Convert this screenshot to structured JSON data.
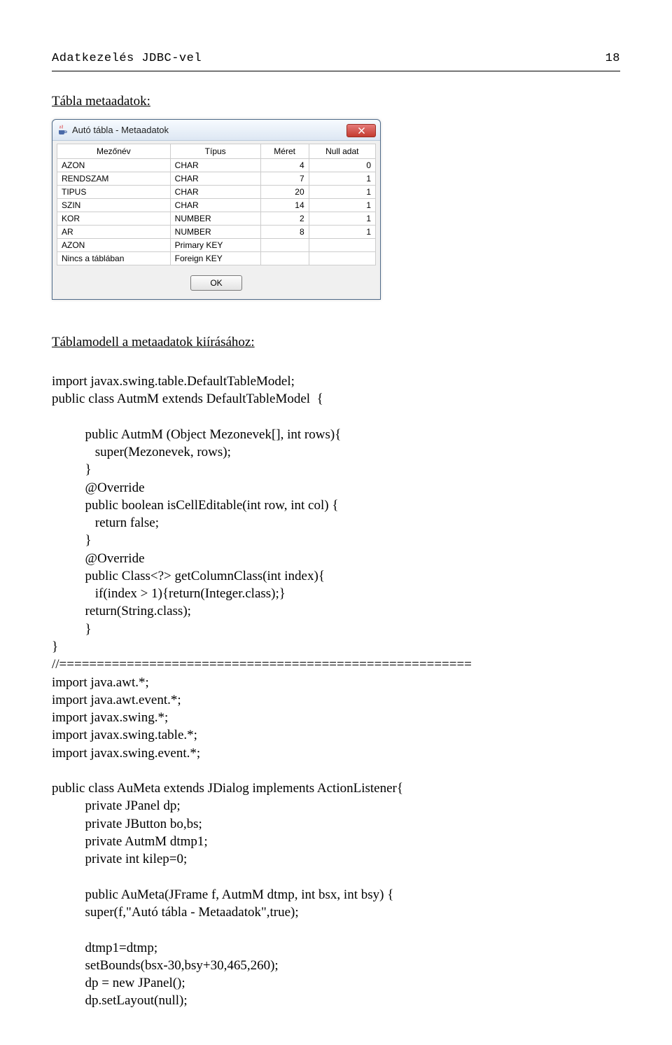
{
  "header": {
    "left": "Adatkezelés JDBC-vel",
    "right": "18"
  },
  "sub1": "Tábla metaadatok:",
  "dialog": {
    "title": "Autó tábla - Metaadatok",
    "columns": [
      "Mezőnév",
      "Típus",
      "Méret",
      "Null adat"
    ],
    "rows": [
      {
        "c0": "AZON",
        "c1": "CHAR",
        "c2": "4",
        "c3": "0"
      },
      {
        "c0": "RENDSZAM",
        "c1": "CHAR",
        "c2": "7",
        "c3": "1"
      },
      {
        "c0": "TIPUS",
        "c1": "CHAR",
        "c2": "20",
        "c3": "1"
      },
      {
        "c0": "SZIN",
        "c1": "CHAR",
        "c2": "14",
        "c3": "1"
      },
      {
        "c0": "KOR",
        "c1": "NUMBER",
        "c2": "2",
        "c3": "1"
      },
      {
        "c0": "AR",
        "c1": "NUMBER",
        "c2": "8",
        "c3": "1"
      },
      {
        "c0": "AZON",
        "c1": "Primary KEY",
        "c2": "",
        "c3": ""
      },
      {
        "c0": "Nincs a táblában",
        "c1": "Foreign KEY",
        "c2": "",
        "c3": ""
      }
    ],
    "ok_label": "OK"
  },
  "sub2": "Táblamodell a metaadatok kiírásához:",
  "code": {
    "l1": "import javax.swing.table.DefaultTableModel;",
    "l2": "public class AutmM extends DefaultTableModel  {",
    "l3": "          public AutmM (Object Mezonevek[], int rows){",
    "l4": "             super(Mezonevek, rows);",
    "l5": "          }",
    "l6": "          @Override",
    "l7": "          public boolean isCellEditable(int row, int col) {",
    "l8": "             return false;",
    "l9": "          }",
    "l10": "          @Override",
    "l11": "          public Class<?> getColumnClass(int index){",
    "l12": "             if(index > 1){return(Integer.class);}",
    "l13": "          return(String.class);",
    "l14": "          }",
    "l15": "}",
    "l16": "//=======================================================",
    "l17": "import java.awt.*;",
    "l18": "import java.awt.event.*;",
    "l19": "import javax.swing.*;",
    "l20": "import javax.swing.table.*;",
    "l21": "import javax.swing.event.*;",
    "l22": "public class AuMeta extends JDialog implements ActionListener{",
    "l23": "          private JPanel dp;",
    "l24": "          private JButton bo,bs;",
    "l25": "          private AutmM dtmp1;",
    "l26": "          private int kilep=0;",
    "l27": "          public AuMeta(JFrame f, AutmM dtmp, int bsx, int bsy) {",
    "l28": "          super(f,\"Autó tábla - Metaadatok\",true);",
    "l29": "          dtmp1=dtmp;",
    "l30": "          setBounds(bsx-30,bsy+30,465,260);",
    "l31": "          dp = new JPanel();",
    "l32": "          dp.setLayout(null);"
  }
}
